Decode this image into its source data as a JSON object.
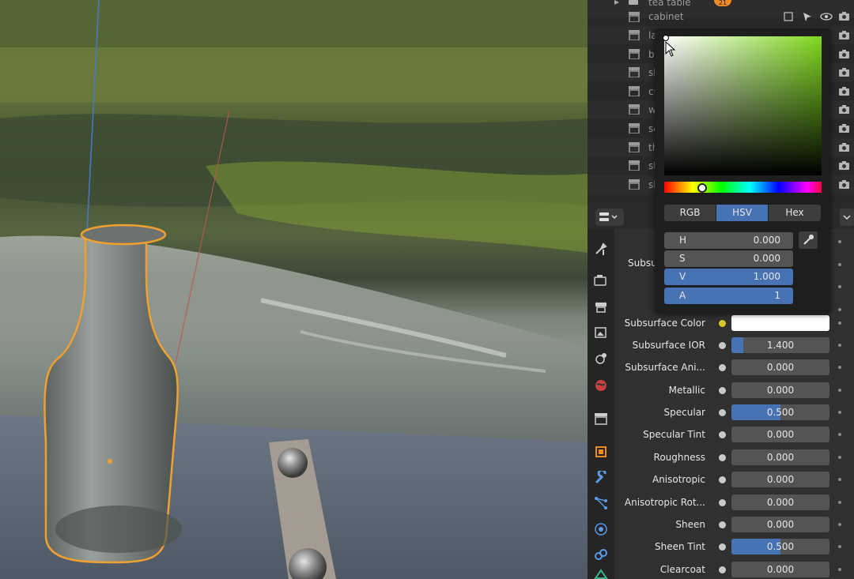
{
  "outliner": {
    "items": [
      {
        "label": "tea table"
      },
      {
        "label": "cabinet"
      },
      {
        "label": "la"
      },
      {
        "label": "b"
      },
      {
        "label": "sh"
      },
      {
        "label": "cu"
      },
      {
        "label": "w"
      },
      {
        "label": "se"
      },
      {
        "label": "th"
      },
      {
        "label": "sh"
      },
      {
        "label": "sh"
      }
    ],
    "badge": "21"
  },
  "properties": {
    "section_label": "Subsu",
    "rows": [
      {
        "label": "Subsurface Color",
        "value": "",
        "fill": 0,
        "swatch": "#ffffff",
        "dot_color": "#d8c82a"
      },
      {
        "label": "Subsurface IOR",
        "value": "1.400",
        "fill": 0.12
      },
      {
        "label": "Subsurface Ani...",
        "value": "0.000",
        "fill": 0
      },
      {
        "label": "Metallic",
        "value": "0.000",
        "fill": 0
      },
      {
        "label": "Specular",
        "value": "0.500",
        "fill": 0.5
      },
      {
        "label": "Specular Tint",
        "value": "0.000",
        "fill": 0
      },
      {
        "label": "Roughness",
        "value": "0.000",
        "fill": 0
      },
      {
        "label": "Anisotropic",
        "value": "0.000",
        "fill": 0
      },
      {
        "label": "Anisotropic Rot...",
        "value": "0.000",
        "fill": 0
      },
      {
        "label": "Sheen",
        "value": "0.000",
        "fill": 0
      },
      {
        "label": "Sheen Tint",
        "value": "0.500",
        "fill": 0.5
      },
      {
        "label": "Clearcoat",
        "value": "0.000",
        "fill": 0
      }
    ]
  },
  "color_picker": {
    "modes": [
      "RGB",
      "HSV",
      "Hex"
    ],
    "active_mode": "HSV",
    "fields": [
      {
        "label": "H",
        "value": "0.000"
      },
      {
        "label": "S",
        "value": "0.000"
      },
      {
        "label": "V",
        "value": "1.000"
      },
      {
        "label": "A",
        "value": "1"
      }
    ],
    "hue_color": "#7fd81e"
  },
  "icons": {
    "tabs": [
      "tool-icon",
      "render-icon",
      "output-icon",
      "view-layer-icon",
      "scene-icon",
      "world-icon",
      "collection-icon",
      "object-icon",
      "modifier-icon",
      "particles-icon",
      "physics-icon",
      "constraints-icon"
    ]
  }
}
